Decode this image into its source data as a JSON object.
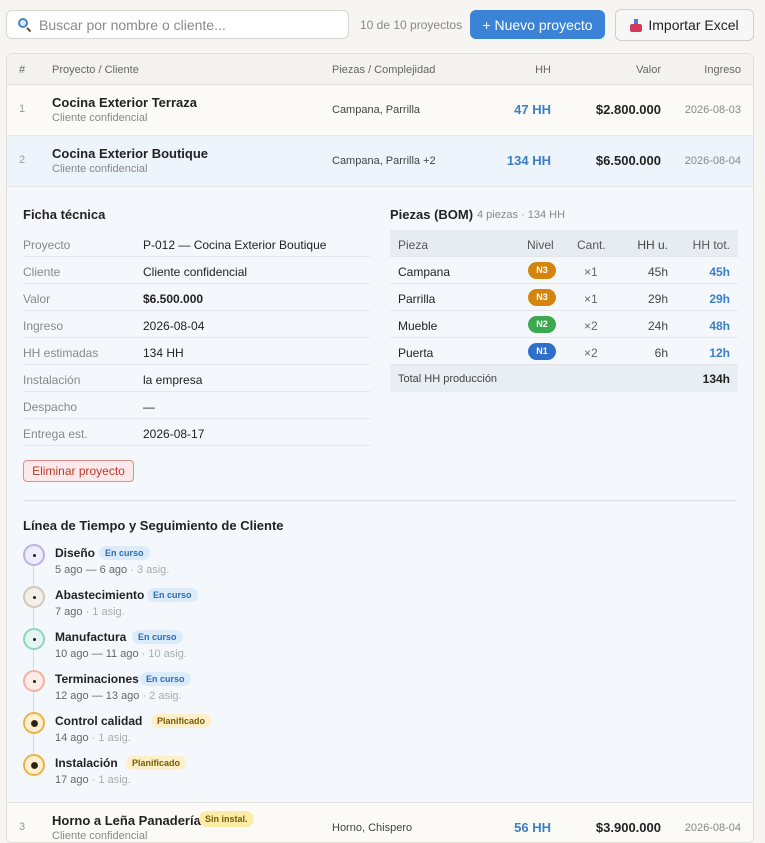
{
  "toolbar": {
    "search_placeholder": "Buscar por nombre o cliente...",
    "count": "10 de 10 proyectos",
    "new_label": "+ Nuevo proyecto",
    "import_label": "Importar Excel"
  },
  "table": {
    "headers": [
      "#",
      "Proyecto / Cliente",
      "Piezas / Complejidad",
      "HH",
      "Valor",
      "Ingreso"
    ],
    "rows": [
      {
        "num": "1",
        "name": "Cocina Exterior Terraza",
        "client": "Cliente confidencial",
        "pieces": "Campana, Parrilla",
        "hh": "47 HH",
        "value": "$2.800.000",
        "date": "2026-08-03"
      },
      {
        "num": "2",
        "name": "Cocina Exterior Boutique",
        "client": "Cliente confidencial",
        "pieces": "Campana, Parrilla +2",
        "hh": "134 HH",
        "value": "$6.500.000",
        "date": "2026-08-04"
      },
      {
        "num": "3",
        "name": "Horno a Leña Panadería",
        "client": "Cliente confidencial",
        "badge": "Sin instal.",
        "pieces": "Horno, Chispero",
        "hh": "56 HH",
        "value": "$3.900.000",
        "date": "2026-08-04"
      }
    ]
  },
  "detail": {
    "ficha_title": "Ficha técnica",
    "ficha": [
      {
        "k": "Proyecto",
        "v": "P-012 — Cocina Exterior Boutique"
      },
      {
        "k": "Cliente",
        "v": "Cliente confidencial"
      },
      {
        "k": "Valor",
        "v": "$6.500.000"
      },
      {
        "k": "Ingreso",
        "v": "2026-08-04"
      },
      {
        "k": "HH estimadas",
        "v": "134 HH"
      },
      {
        "k": "Instalación",
        "v": "la empresa"
      },
      {
        "k": "Despacho",
        "v": "—"
      },
      {
        "k": "Entrega est.",
        "v": "2026-08-17"
      }
    ],
    "delete_label": "Eliminar proyecto",
    "bom_title": "Piezas (BOM)",
    "bom_sub": "4 piezas · 134 HH",
    "bom_headers": [
      "Pieza",
      "Nivel",
      "Cant.",
      "HH u.",
      "HH tot."
    ],
    "bom": [
      {
        "pieza": "Campana",
        "nivel": "N3",
        "color": "#d4850e",
        "cant": "×1",
        "hhu": "45h",
        "hht": "45h"
      },
      {
        "pieza": "Parrilla",
        "nivel": "N3",
        "color": "#d4850e",
        "cant": "×1",
        "hhu": "29h",
        "hht": "29h"
      },
      {
        "pieza": "Mueble",
        "nivel": "N2",
        "color": "#3da84f",
        "cant": "×2",
        "hhu": "24h",
        "hht": "48h"
      },
      {
        "pieza": "Puerta",
        "nivel": "N1",
        "color": "#2d6fca",
        "cant": "×2",
        "hhu": "6h",
        "hht": "12h"
      }
    ],
    "bom_total_label": "Total HH producción",
    "bom_total": "134h",
    "timeline_title": "Línea de Tiempo y Seguimiento de Cliente",
    "stages": [
      {
        "name": "Diseño",
        "status": "En curso",
        "kind": "cur",
        "dates": "5 ago — 6 ago",
        "asig": " · 3 asig.",
        "ring": "#b9b3e6",
        "fill": "#efedfb"
      },
      {
        "name": "Abastecimiento",
        "status": "En curso",
        "kind": "cur",
        "dates": "7 ago",
        "asig": " · 1 asig.",
        "ring": "#cfcab8",
        "fill": "#f2f0e8"
      },
      {
        "name": "Manufactura",
        "status": "En curso",
        "kind": "cur",
        "dates": "10 ago — 11 ago",
        "asig": " · 10 asig.",
        "ring": "#8fd4bf",
        "fill": "#e4f6f0"
      },
      {
        "name": "Terminaciones",
        "status": "En curso",
        "kind": "cur",
        "dates": "12 ago — 13 ago",
        "asig": " · 2 asig.",
        "ring": "#f0b59d",
        "fill": "#fdece4"
      },
      {
        "name": "Control calidad",
        "status": "Planificado",
        "kind": "plan",
        "dates": "14 ago",
        "asig": " · 1 asig.",
        "ring": "#e8b44a",
        "fill": "#fcefd2"
      },
      {
        "name": "Instalación",
        "status": "Planificado",
        "kind": "plan",
        "dates": "17 ago",
        "asig": " · 1 asig.",
        "ring": "#e8b44a",
        "fill": "#fcefd2"
      }
    ]
  }
}
